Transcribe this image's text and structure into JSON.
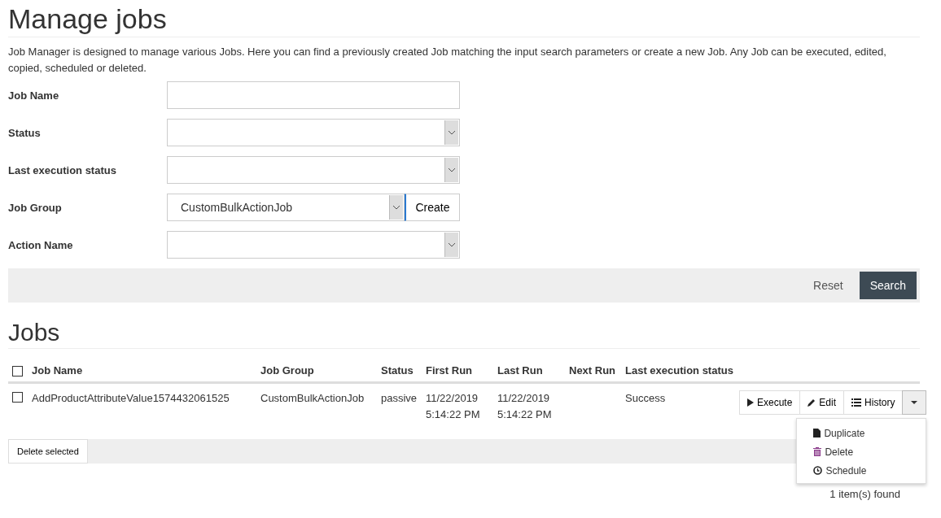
{
  "title": "Manage jobs",
  "description": "Job Manager is designed to manage various Jobs. Here you can find a previously created Job matching the input search parameters or create a new Job. Any Job can be executed, edited, copied, scheduled or deleted.",
  "form": [
    {
      "label": "Job Name",
      "kind": "text"
    },
    {
      "label": "Status",
      "kind": "select"
    },
    {
      "label": "Last execution status",
      "kind": "select"
    },
    {
      "label": "Job Group",
      "kind": "select",
      "value": "CustomBulkActionJob",
      "button": "Create"
    },
    {
      "label": "Action Name",
      "kind": "select"
    }
  ],
  "search_bar": {
    "reset": "Reset",
    "search": "Search"
  },
  "jobs": {
    "title": "Jobs",
    "columns": [
      "Job Name",
      "Job Group",
      "Status",
      "First Run",
      "Last Run",
      "Next Run",
      "Last execution status"
    ],
    "header_checked": false,
    "rows": [
      {
        "checked": false,
        "cells": [
          "AddProductAttributeValue1574432061525",
          "CustomBulkActionJob",
          "passive",
          "11/22/2019 5:14:22 PM",
          "11/22/2019 5:14:22 PM",
          "",
          "Success"
        ]
      }
    ],
    "actions": [
      "Execute",
      "Edit",
      "History"
    ],
    "menu": [
      "Duplicate",
      "Delete",
      "Schedule"
    ],
    "menu_expanded": true,
    "delete_selected": "Delete selected",
    "count": "1 item(s) found"
  }
}
